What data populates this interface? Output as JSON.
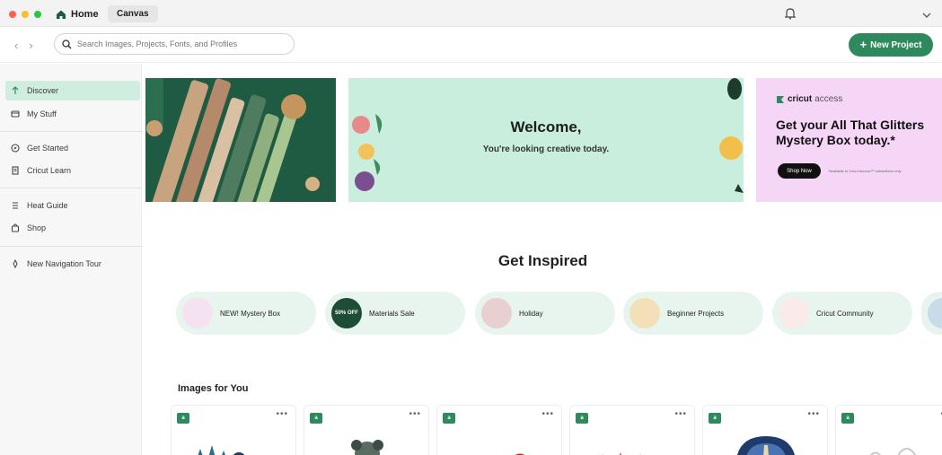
{
  "titlebar": {
    "home_tab": "Home",
    "canvas_tab": "Canvas",
    "dot_colors": [
      "#ff5f57",
      "#febc2e",
      "#28c840"
    ]
  },
  "toolbar": {
    "search_placeholder": "Search Images, Projects, Fonts, and Profiles",
    "new_project": "New Project"
  },
  "sidebar": {
    "items": [
      {
        "label": "Discover",
        "icon": "discover-icon",
        "active": true
      },
      {
        "label": "My Stuff",
        "icon": "folder-icon"
      },
      {
        "label": "Get Started",
        "icon": "compass-icon"
      },
      {
        "label": "Cricut Learn",
        "icon": "book-icon"
      },
      {
        "label": "Heat Guide",
        "icon": "heat-icon"
      },
      {
        "label": "Shop",
        "icon": "bag-icon"
      },
      {
        "label": "New Navigation Tour",
        "icon": "tour-icon"
      }
    ]
  },
  "banners": {
    "welcome_title": "Welcome,",
    "welcome_subtitle": "You're looking creative today.",
    "access_brand": "cricut",
    "access_word": "access",
    "promo_text": "Get your All That Glitters Mystery Box today.*",
    "shop_now": "Shop Now",
    "fine_print": "*Available to Cricut Access™ subscribers only"
  },
  "inspired": {
    "title": "Get Inspired",
    "chips": [
      {
        "label": "NEW! Mystery Box"
      },
      {
        "label": "Materials Sale",
        "thumb_text": "50% OFF"
      },
      {
        "label": "Holiday"
      },
      {
        "label": "Beginner Projects"
      },
      {
        "label": "Cricut Community"
      }
    ]
  },
  "images": {
    "title": "Images for You",
    "badge": "a",
    "more": "•••"
  },
  "colors": {
    "accent": "#2e8a5c",
    "active_bg": "#cfeee0"
  }
}
